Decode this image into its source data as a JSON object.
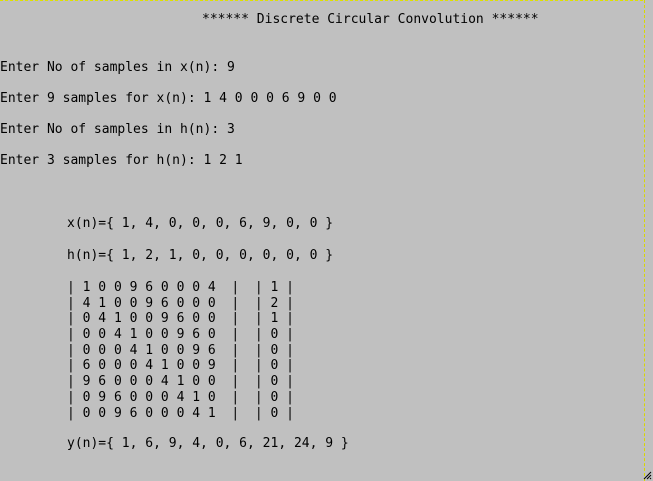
{
  "title": "****** Discrete Circular Convolution ******",
  "prompts": [
    "Enter No of samples in x(n): 9",
    "Enter 9 samples for x(n): 1 4 0 0 0 6 9 0 0",
    "Enter No of samples in h(n): 3",
    "Enter 3 samples for h(n): 1 2 1"
  ],
  "sequences": {
    "x": "x(n)={ 1, 4, 0, 0, 0, 6, 9, 0, 0 }",
    "h": "h(n)={ 1, 2, 1, 0, 0, 0, 0, 0, 0 }",
    "y": "y(n)={ 1, 6, 9, 4, 0, 6, 21, 24, 9 }"
  },
  "matrix_rows": [
    "| 1 0 0 9 6 0 0 0 4  |  | 1 |",
    "| 4 1 0 0 9 6 0 0 0  |  | 2 |",
    "| 0 4 1 0 0 9 6 0 0  |  | 1 |",
    "| 0 0 4 1 0 0 9 6 0  |  | 0 |",
    "| 0 0 0 4 1 0 0 9 6  |  | 0 |",
    "| 6 0 0 0 4 1 0 0 9  |  | 0 |",
    "| 9 6 0 0 0 4 1 0 0  |  | 0 |",
    "| 0 9 6 0 0 0 4 1 0  |  | 0 |",
    "| 0 0 9 6 0 0 0 4 1  |  | 0 |"
  ]
}
